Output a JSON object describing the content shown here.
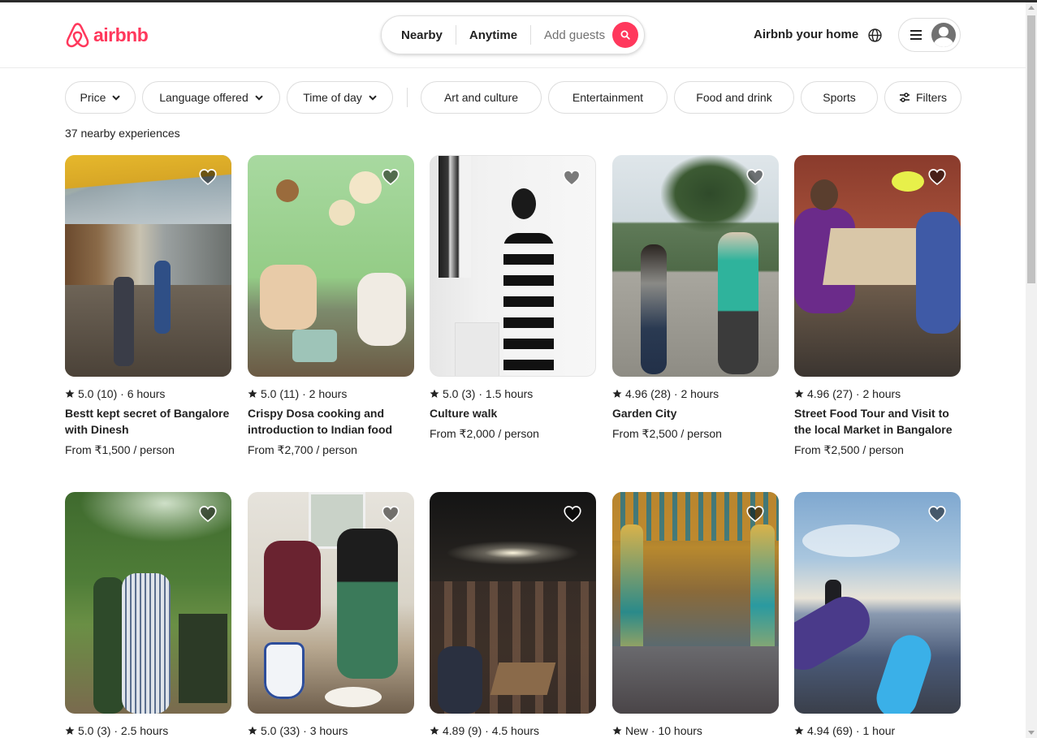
{
  "header": {
    "logo_text": "airbnb",
    "search": {
      "location": "Nearby",
      "date": "Anytime",
      "guests_placeholder": "Add guests"
    },
    "host_link": "Airbnb your home"
  },
  "filters": {
    "dropdowns": [
      {
        "label": "Price"
      },
      {
        "label": "Language offered"
      },
      {
        "label": "Time of day"
      }
    ],
    "categories": [
      {
        "label": "Art and culture"
      },
      {
        "label": "Entertainment"
      },
      {
        "label": "Food and drink"
      },
      {
        "label": "Sports"
      }
    ],
    "more_filters_label": "Filters"
  },
  "results_count": "37 nearby experiences",
  "experiences": [
    {
      "meta": "5.0 (10) · 6 hours",
      "title": "Bestt kept secret of Bangalore with Dinesh",
      "price": "From ₹1,500 / person"
    },
    {
      "meta": "5.0 (11) · 2 hours",
      "title": "Crispy Dosa cooking and introduction to Indian food",
      "price": "From ₹2,700 / person"
    },
    {
      "meta": "5.0 (3) · 1.5 hours",
      "title": "Culture walk",
      "price": "From ₹2,000 / person"
    },
    {
      "meta": "4.96 (28) · 2 hours",
      "title": "Garden City",
      "price": "From ₹2,500 / person"
    },
    {
      "meta": "4.96 (27) · 2 hours",
      "title": "Street Food Tour and Visit to the local Market in Bangalore",
      "price": "From ₹2,500 / person"
    },
    {
      "meta": "5.0 (3) · 2.5 hours",
      "title": "",
      "price": ""
    },
    {
      "meta": "5.0 (33) · 3 hours",
      "title": "",
      "price": ""
    },
    {
      "meta": "4.89 (9) · 4.5 hours",
      "title": "",
      "price": ""
    },
    {
      "meta": "New · 10 hours",
      "title": "",
      "price": ""
    },
    {
      "meta": "4.94 (69) · 1 hour",
      "title": "",
      "price": ""
    }
  ],
  "colors": {
    "brand": "#FF385C",
    "text": "#222222",
    "muted": "#717171",
    "border": "#DDDDDD"
  }
}
